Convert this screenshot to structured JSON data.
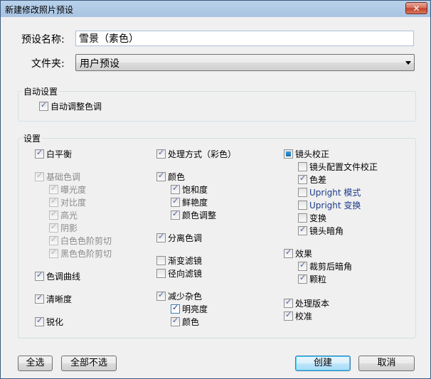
{
  "window": {
    "title": "新建修改照片预设",
    "close_label": "✕"
  },
  "form": {
    "name_label": "预设名称:",
    "name_value": "雪景（素色）",
    "folder_label": "文件夹:",
    "folder_value": "用户预设"
  },
  "auto_settings": {
    "legend": "自动设置",
    "auto_tone": {
      "label": "自动调整色调",
      "checked": true
    }
  },
  "settings": {
    "legend": "设置",
    "col1": {
      "white_balance": "白平衡",
      "basic_tone": "基础色调",
      "exposure": "曝光度",
      "contrast": "对比度",
      "highlights": "高光",
      "shadows": "阴影",
      "white_clipping": "白色色阶剪切",
      "black_clipping": "黑色色阶剪切",
      "tone_curve": "色调曲线",
      "clarity": "清晰度",
      "sharpening": "锐化"
    },
    "col2": {
      "treatment": "处理方式（彩色）",
      "color": "颜色",
      "saturation": "饱和度",
      "vibrance": "鲜艳度",
      "color_adjust": "颜色调整",
      "split_toning": "分离色调",
      "graduated_filters": "渐变滤镜",
      "radial_filters": "径向滤镜",
      "noise_reduction": "减少杂色",
      "luminance": "明亮度",
      "nr_color": "颜色"
    },
    "col3": {
      "lens_corrections": "镜头校正",
      "lens_profile": "镜头配置文件校正",
      "chromatic_aberration": "色差",
      "upright_mode": "Upright 模式",
      "upright_transforms": "Upright 变换",
      "transform": "变换",
      "lens_vignetting": "镜头暗角",
      "effects": "效果",
      "post_crop_vignetting": "裁剪后暗角",
      "grain": "颗粒",
      "process_version": "处理版本",
      "calibration": "校准"
    }
  },
  "buttons": {
    "check_all": "全选",
    "check_none": "全部不选",
    "create": "创建",
    "cancel": "取消"
  }
}
